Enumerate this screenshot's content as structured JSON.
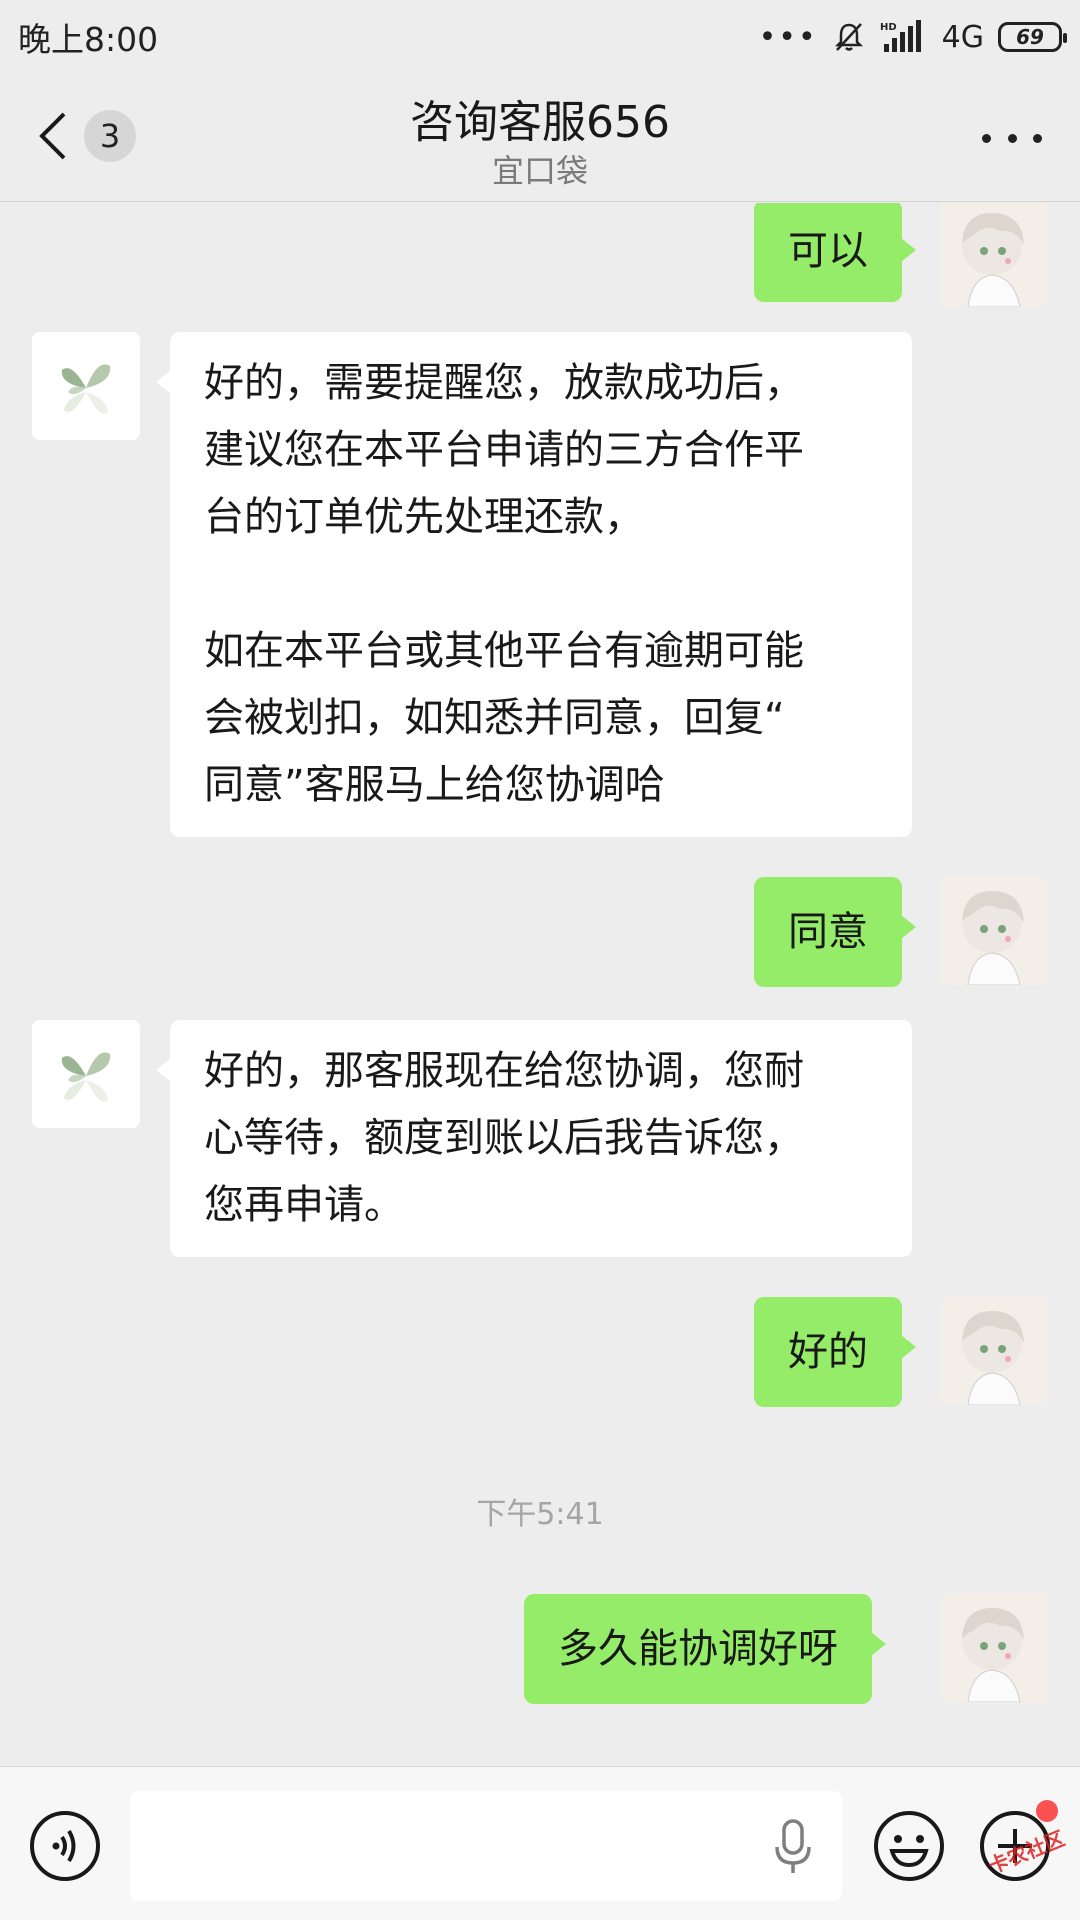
{
  "status_bar": {
    "time": "晚上8:00",
    "dots": "•••",
    "network": "4G",
    "battery": "69"
  },
  "nav": {
    "unread_count": "3",
    "title": "咨询客服656",
    "subtitle": "宜口袋"
  },
  "messages": [
    {
      "sender": "self",
      "text": "可以"
    },
    {
      "sender": "agent",
      "text": "好的，需要提醒您，放款成功后，\n建议您在本平台申请的三方合作平\n台的订单优先处理还款，\n\n如在本平台或其他平台有逾期可能\n会被划扣，如知悉并同意，回复“\n同意”客服马上给您协调哈"
    },
    {
      "sender": "self",
      "text": "同意"
    },
    {
      "sender": "agent",
      "text": "好的，那客服现在给您协调，您耐\n心等待，额度到账以后我告诉您，\n您再申请。"
    },
    {
      "sender": "self",
      "text": "好的"
    },
    {
      "sender": "self",
      "text": "多久能协调好呀"
    }
  ],
  "timestamp": "下午5:41",
  "input": {
    "value": "",
    "placeholder": ""
  },
  "icons": {
    "back": "chevron-left-icon",
    "more": "more-dots-icon",
    "voice": "voice-icon",
    "mic": "microphone-icon",
    "emoji": "emoji-icon",
    "plus": "plus-icon"
  },
  "colors": {
    "self_bubble": "#95ec69",
    "agent_bubble": "#ffffff",
    "background": "#ededed",
    "badge_dot": "#fa5151"
  },
  "watermark": "卡农社区"
}
